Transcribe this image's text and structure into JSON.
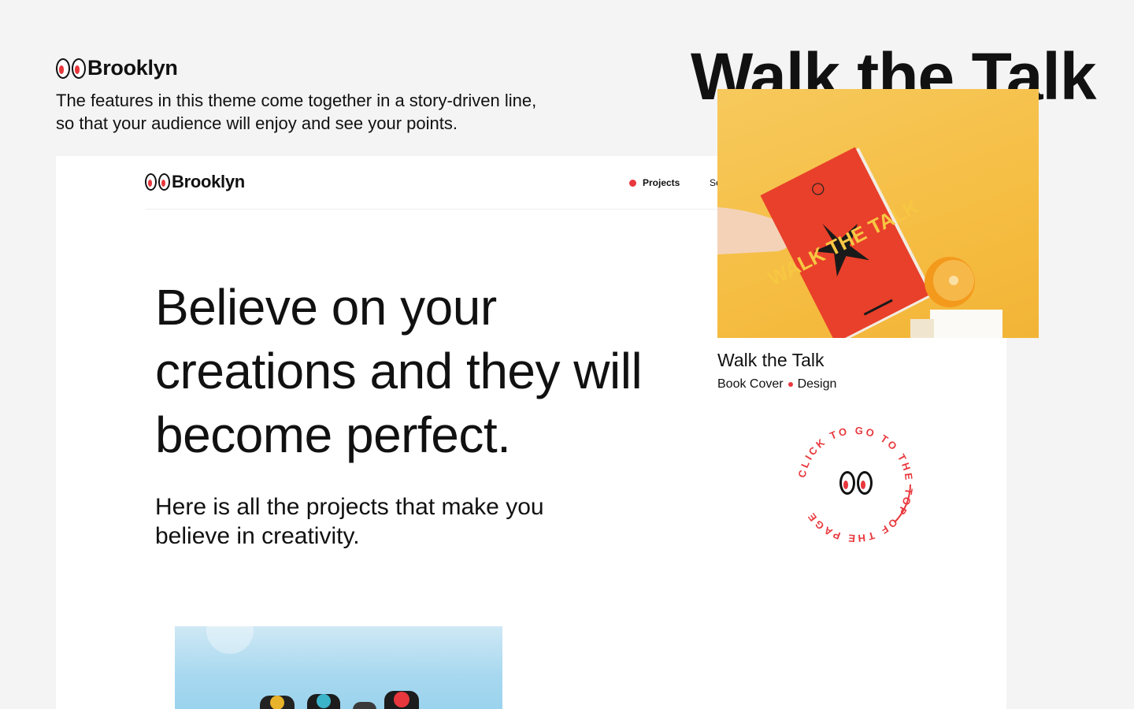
{
  "brand": {
    "name": "Brooklyn"
  },
  "intro": {
    "line1": "The features in this theme come together in a story-driven line,",
    "line2": "so that your audience will enjoy and see your points."
  },
  "hero_title": "Walk the Talk",
  "nav": {
    "logo": "Brooklyn",
    "items": [
      {
        "label": "Projects",
        "active": true
      },
      {
        "label": "Se"
      }
    ]
  },
  "headline": {
    "line1": "Believe on your",
    "line2": "creations and they will",
    "line3": "become perfect."
  },
  "subline": {
    "line1": "Here is all the projects that make you",
    "line2": "believe in creativity."
  },
  "card": {
    "title": "Walk the Talk",
    "category": "Book Cover",
    "tag": "Design",
    "book_cover_text": "WALK THE TALK"
  },
  "badge": {
    "circle_text": "CLICK TO GO TO THE TOP OF THE PAGE"
  },
  "colors": {
    "accent": "#e8383d",
    "background": "#f4f4f4",
    "card_bg": "#f5bd42",
    "book": "#e8402a"
  }
}
